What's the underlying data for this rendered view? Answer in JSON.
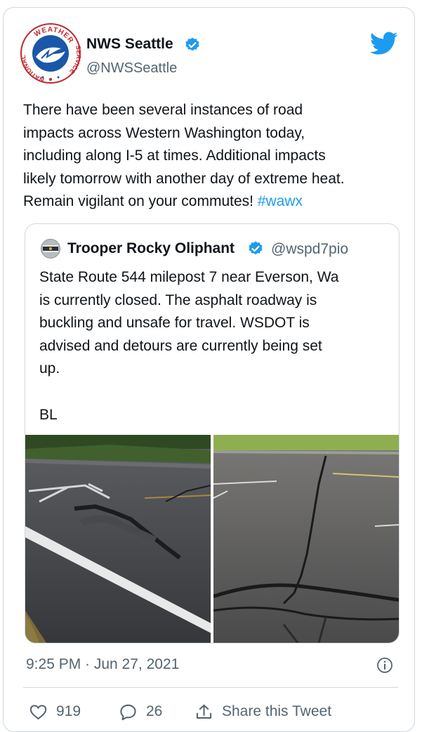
{
  "tweet": {
    "author_name": "NWS Seattle",
    "author_handle": "@NWSSeattle",
    "text": "There have been several instances of road\nimpacts across Western Washington today,\nincluding along I-5 at times. Additional impacts\nlikely tomorrow with another day of extreme heat.\nRemain vigilant on your commutes! ",
    "hashtag": "#wawx",
    "timestamp": "9:25 PM · Jun 27, 2021"
  },
  "logo": {
    "top_text": "WEATHER",
    "left_text": "NATIONAL",
    "right_text": "SERVICE"
  },
  "quoted_tweet": {
    "author_name": "Trooper Rocky Oliphant",
    "author_handle": "@wspd7pio",
    "text": "State Route 544 milepost 7 near Everson, Wa\nis currently closed. The asphalt roadway is\nbuckling and unsafe for travel. WSDOT is\nadvised and detours are currently being set\nup.\n\nBL"
  },
  "actions": {
    "like_count": "919",
    "reply_count": "26",
    "share_label": "Share this Tweet"
  },
  "colors": {
    "accent": "#1d9bf0",
    "text": "#0f1419",
    "muted": "#536471",
    "border": "#cfd9de"
  }
}
